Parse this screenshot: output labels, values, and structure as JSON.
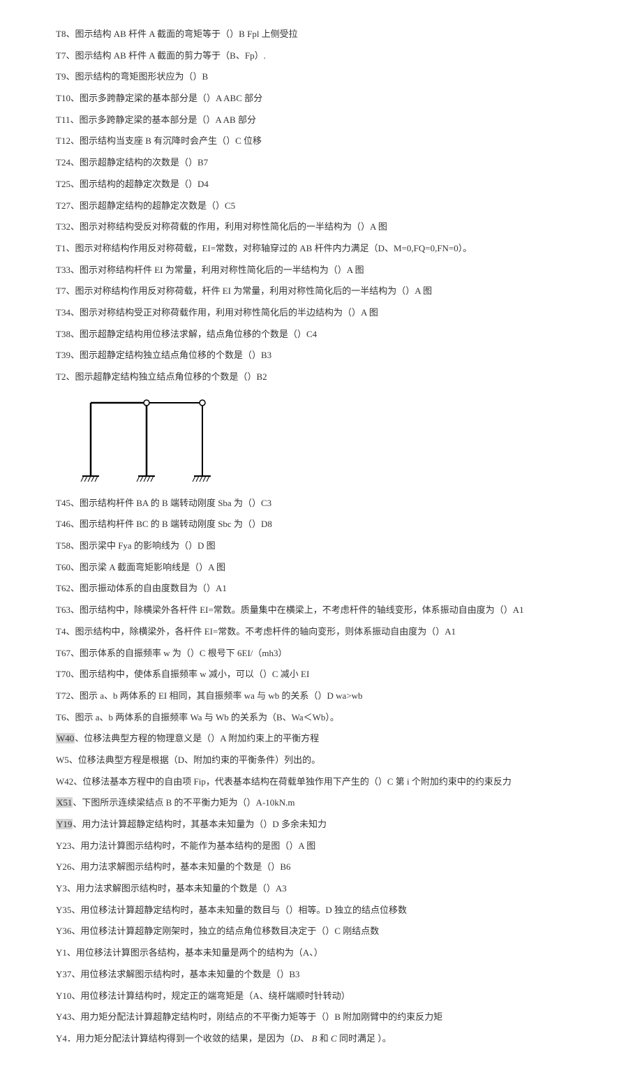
{
  "lines": [
    {
      "id": "t8",
      "text": "T8、图示结构 AB 杆件 A 截面的弯矩等于（）B  Fpl 上侧受拉"
    },
    {
      "id": "t7a",
      "text": "T7、图示结构 AB 杆件 A 截面的剪力等于（B、Fp）."
    },
    {
      "id": "t9",
      "text": "T9、图示结构的弯矩图形状应为（）B"
    },
    {
      "id": "t10",
      "text": "T10、图示多跨静定梁的基本部分是（）A   ABC 部分"
    },
    {
      "id": "t11",
      "text": "T11、图示多跨静定梁的基本部分是（）A   AB 部分"
    },
    {
      "id": "t12",
      "text": "T12、图示结构当支座 B 有沉降时会产生（）C 位移"
    },
    {
      "id": "t24",
      "text": "T24、图示超静定结构的次数是（）B7"
    },
    {
      "id": "t25",
      "text": "T25、图示结构的超静定次数是（）D4"
    },
    {
      "id": "t27",
      "text": "T27、图示超静定结构的超静定次数是（）C5"
    },
    {
      "id": "t32",
      "text": "T32、图示对称结构受反对称荷载的作用，利用对称性简化后的一半结构为（）A 图"
    },
    {
      "id": "t1",
      "text": "T1、图示对称结构作用反对称荷载，EI=常数，对称轴穿过的 AB 杆件内力满足（D、M=0,FQ=0,FN=0）。"
    },
    {
      "id": "t33",
      "text": "T33、图示对称结构杆件 EI 为常量，利用对称性简化后的一半结构为（）A 图"
    },
    {
      "id": "t7b",
      "text": "T7、图示对称结构作用反对称荷载，杆件 EI 为常量，利用对称性简化后的一半结构为（）A 图"
    },
    {
      "id": "t34",
      "text": "T34、图示对称结构受正对称荷载作用，利用对称性简化后的半边结构为（）A 图"
    },
    {
      "id": "t38",
      "text": "T38、图示超静定结构用位移法求解，结点角位移的个数是（）C4"
    },
    {
      "id": "t39",
      "text": "T39、图示超静定结构独立结点角位移的个数是（）B3"
    },
    {
      "id": "t2",
      "text": "T2、图示超静定结构独立结点角位移的个数是（）B2"
    }
  ],
  "lines2": [
    {
      "id": "t45",
      "text": "T45、图示结构杆件 BA 的 B 端转动刚度 Sba 为（）C3"
    },
    {
      "id": "t46",
      "text": "T46、图示结构杆件 BC 的 B 端转动刚度 Sbc 为（）D8"
    },
    {
      "id": "t58",
      "text": "T58、图示梁中 Fya 的影响线为（）D 图"
    },
    {
      "id": "t60",
      "text": "T60、图示梁 A 截面弯矩影响线是（）A 图"
    },
    {
      "id": "t62",
      "text": "T62、图示振动体系的自由度数目为（）A1"
    },
    {
      "id": "t63",
      "text": "T63、图示结构中，除横梁外各杆件 EI=常数。质量集中在横梁上，不考虑杆件的轴线变形，体系振动自由度为（）A1"
    },
    {
      "id": "t4",
      "text": "T4、图示结构中，除横梁外，各杆件 EI=常数。不考虑杆件的轴向变形，则体系振动自由度为（）A1"
    },
    {
      "id": "t67",
      "text": "T67、图示体系的自振频率 w 为（）C 根号下 6EI/（mh3）"
    },
    {
      "id": "t70",
      "text": "T70、图示结构中，使体系自振频率 w 减小，可以（）C 减小 EI"
    },
    {
      "id": "t72",
      "text": "T72、图示 a、b 两体系的 EI 相同，其自振频率 wa 与 wb 的关系（）D  wa>wb"
    },
    {
      "id": "t6",
      "text": "T6、图示 a、b 两体系的自振频率 Wa 与 Wb 的关系为（B、Wa＜Wb）。"
    },
    {
      "id": "w40",
      "prefix": "W40",
      "text": "、位移法典型方程的物理意义是（）A 附加约束上的平衡方程",
      "highlight": true
    },
    {
      "id": "w5",
      "text": "W5、位移法典型方程是根据（D、附加约束的平衡条件）列出的。"
    },
    {
      "id": "w42",
      "text": "W42、位移法基本方程中的自由项 Fip，代表基本结构在荷载单独作用下产生的（）C 第 i 个附加约束中的约束反力"
    },
    {
      "id": "x51",
      "prefix": "X51",
      "text": "、下图所示连续梁结点 B 的不平衡力矩为（）A-10kN.m",
      "highlight": true
    },
    {
      "id": "y19",
      "prefix": "Y19",
      "text": "、用力法计算超静定结构时，其基本未知量为（）D 多余未知力",
      "highlight": true
    },
    {
      "id": "y23",
      "text": "Y23、用力法计算图示结构时，不能作为基本结构的是图（）A 图"
    },
    {
      "id": "y26",
      "text": "Y26、用力法求解图示结构时，基本未知量的个数是（）B6"
    },
    {
      "id": "y3",
      "text": "Y3、用力法求解图示结构时，基本未知量的个数是（）A3"
    },
    {
      "id": "y35",
      "text": "Y35、用位移法计算超静定结构时，基本未知量的数目与（）相等。D 独立的结点位移数"
    },
    {
      "id": "y36",
      "text": "Y36、用位移法计算超静定刚架时，独立的结点角位移数目决定于（）C 刚结点数"
    },
    {
      "id": "y1",
      "text": "Y1、用位移法计算图示各结构，基本未知量是两个的结构为（A、）"
    },
    {
      "id": "y37",
      "text": "Y37、用位移法求解图示结构时，基本未知量的个数是（）B3"
    },
    {
      "id": "y10",
      "text": "Y10、用位移法计算结构时，规定正的端弯矩是（A、绕杆端顺时针转动）"
    },
    {
      "id": "y43",
      "text": "Y43、用力矩分配法计算超静定结构时，刚结点的不平衡力矩等于（）B 附加刚臂中的约束反力矩"
    }
  ],
  "y4": {
    "prefix": "Y4．用力矩分配法计算结构得到一个收敛的结果，是因为（",
    "italic1": "D",
    "mid1": "、  ",
    "italic2": "B",
    "mid2": " 和 ",
    "italic3": "C",
    "suffix": " 同时满足   ）。"
  }
}
